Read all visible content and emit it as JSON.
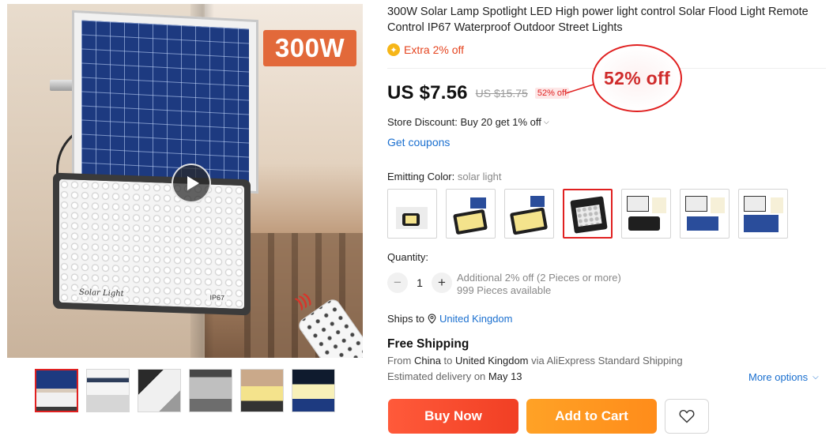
{
  "gallery": {
    "badge_text": "300W",
    "panel_label": "Solar Light",
    "panel_ip_label": "IP67",
    "play_icon": "play-icon",
    "thumbnails_count_label": ""
  },
  "product": {
    "title": "300W Solar Lamp Spotlight LED High power light control Solar Flood Light Remote Control IP67 Waterproof Outdoor Street Lights",
    "extra_discount": "Extra 2% off",
    "extra_icon": "coin-icon",
    "price": "US $7.56",
    "old_price": "US $15.75",
    "discount_small": "52% off",
    "discount_callout": "52% off",
    "store_discount": "Store Discount: Buy 20 get 1% off",
    "get_coupons": "Get coupons"
  },
  "variant": {
    "label": "Emitting Color: ",
    "value": "solar light",
    "selected_index": 3,
    "options_count": 7
  },
  "quantity": {
    "label": "Quantity:",
    "value": "1",
    "minus": "−",
    "plus": "+",
    "additional_offer": "Additional 2% off (2 Pieces or more)",
    "available": "999 Pieces available"
  },
  "shipping": {
    "ships_to_label": "Ships to",
    "country": "United Kingdom",
    "free_shipping": "Free Shipping",
    "from_prefix": "From ",
    "from_country": "China",
    "to_word": " to ",
    "to_country": "United Kingdom",
    "via": " via AliExpress Standard Shipping",
    "estimated_prefix": "Estimated delivery on ",
    "estimated_date": "May 13",
    "more_options": "More options"
  },
  "actions": {
    "buy_now": "Buy Now",
    "add_to_cart": "Add to Cart",
    "wishlist_icon": "heart-icon"
  },
  "colors": {
    "accent_red": "#e02020",
    "buy_now": "#f13f24",
    "add_to_cart": "#ff8c1a",
    "link_blue": "#1a6fcf",
    "extra_orange": "#e5441f"
  }
}
